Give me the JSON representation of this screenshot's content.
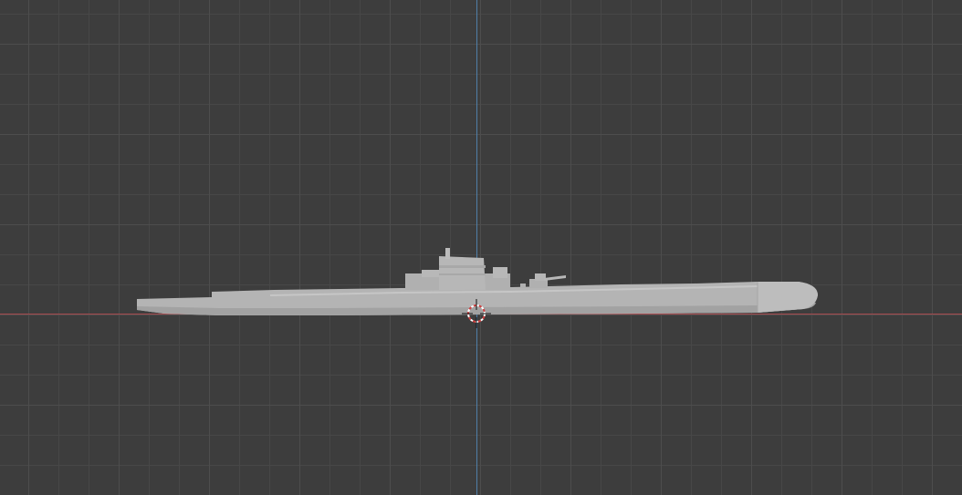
{
  "viewport": {
    "name": "3D Viewport",
    "background": "#3d3d3d",
    "grid_minor_color": "#474747",
    "grid_major_color": "#4d4d4d",
    "axis_x_color": "#a84b4f",
    "axis_y_color": "#4f7fa8"
  },
  "object": {
    "kind": "submarine-mesh",
    "color": "#b4b4b4",
    "shade_color": "#a0a0a0",
    "highlight_color": "#c4c4c4"
  },
  "cursor": {
    "icon": "3d-cursor-icon",
    "ring_color_a": "#d04040",
    "ring_color_b": "#ffffff"
  }
}
